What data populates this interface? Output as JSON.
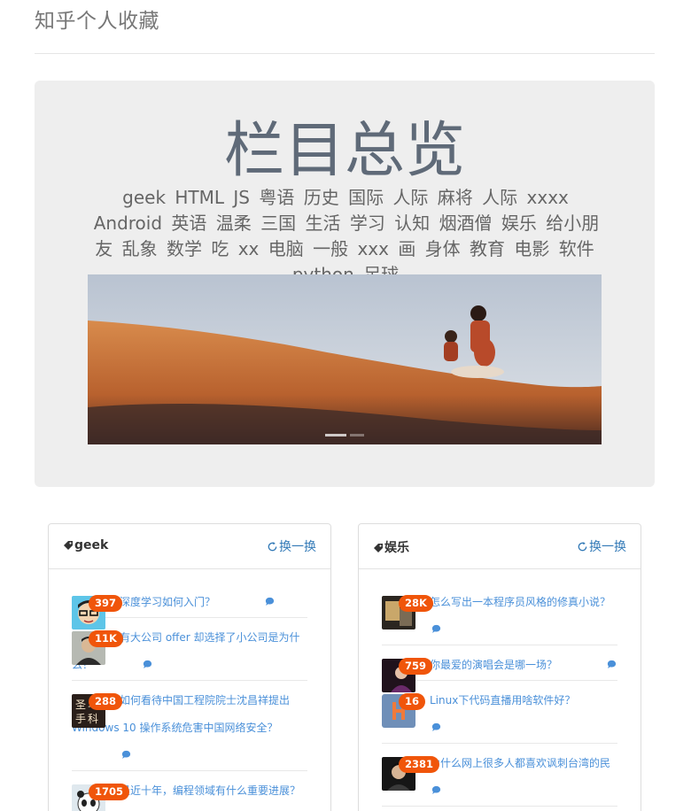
{
  "header": {
    "title": "知乎个人收藏"
  },
  "overview": {
    "heading": "栏目总览",
    "tags": [
      "geek",
      "HTML",
      "JS",
      "粤语",
      "历史",
      "国际",
      "人际",
      "麻将",
      "人际",
      "xxxx",
      "Android",
      "英语",
      "温柔",
      "三国",
      "生活",
      "学习",
      "认知",
      "烟酒僧",
      "娱乐",
      "给小朋友",
      "乱象",
      "数学",
      "吃",
      "xx",
      "电脑",
      "一般",
      "xxx",
      "画",
      "身体",
      "教育",
      "电影",
      "软件",
      "python",
      "足球"
    ]
  },
  "carousel": {
    "slides": 2,
    "active_index": 0
  },
  "panels": [
    {
      "title": "geek",
      "refresh_label": "换一换",
      "items": [
        {
          "count": "397",
          "question": "深度学习如何入门？",
          "avatar": "cartoon-glasses-avatar"
        },
        {
          "count": "11K",
          "question": "有大公司 offer 却选择了小公司是为什么？",
          "avatar": "man-photo-avatar"
        },
        {
          "count": "288",
          "question": "如何看待中国工程院院士沈昌祥提出 Windows 10 操作系统危害中国网络安全？",
          "avatar": "calligraphy-avatar"
        },
        {
          "count": "1705",
          "question": "最近十年，编程领域有什么重要进展？",
          "avatar": "panda-avatar"
        }
      ]
    },
    {
      "title": "娱乐",
      "refresh_label": "换一换",
      "items": [
        {
          "count": "28K",
          "question": "怎么写出一本程序员风格的修真小说？",
          "avatar": "dark-photo-avatar"
        },
        {
          "count": "759",
          "question": "你最爱的演唱会是哪一场？",
          "avatar": "purple-photo-avatar"
        },
        {
          "count": "16",
          "question": "Linux下代码直播用啥软件好？",
          "avatar": "orange-logo-avatar"
        },
        {
          "count": "2381",
          "question": "为什么网上很多人都喜欢讽刺台湾的民",
          "avatar": "portrait-avatar"
        }
      ]
    }
  ],
  "colors": {
    "badge": "#f0550a",
    "link": "#337ab7",
    "jumbotron_bg": "#eeeeee"
  }
}
